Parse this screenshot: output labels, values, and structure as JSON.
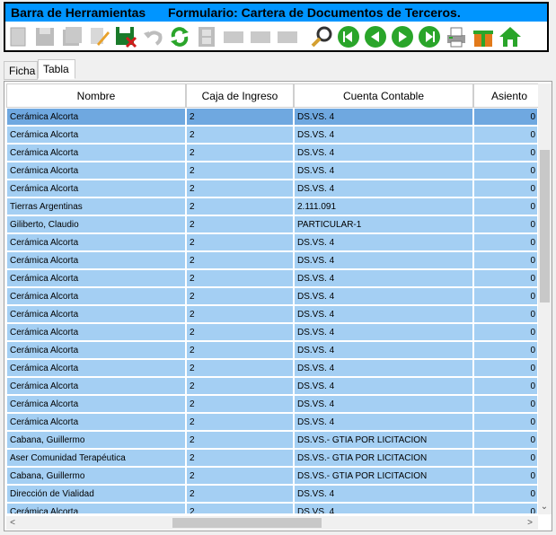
{
  "toolbar": {
    "title": "Barra de Herramientas",
    "form_title": "Formulario: Cartera de Documentos de Terceros.",
    "buttons": [
      {
        "name": "new-record-button",
        "icon": "document-icon",
        "enabled": false
      },
      {
        "name": "save-button",
        "icon": "floppy-icon",
        "enabled": false
      },
      {
        "name": "save-as-button",
        "icon": "floppy-stack-icon",
        "enabled": false
      },
      {
        "name": "edit-button",
        "icon": "pencil-icon",
        "enabled": false
      },
      {
        "name": "delete-button",
        "icon": "floppy-delete-icon",
        "enabled": true
      },
      {
        "name": "undo-button",
        "icon": "undo-icon",
        "enabled": false
      },
      {
        "name": "refresh-button",
        "icon": "refresh-icon",
        "enabled": true
      },
      {
        "name": "film-button",
        "icon": "film-icon",
        "enabled": false
      },
      {
        "name": "disabled-button-1",
        "icon": "blank-icon",
        "enabled": false
      },
      {
        "name": "disabled-button-2",
        "icon": "blank-icon",
        "enabled": false
      },
      {
        "name": "disabled-button-3",
        "icon": "blank-icon",
        "enabled": false
      },
      {
        "name": "search-button",
        "icon": "magnifier-icon",
        "enabled": true
      },
      {
        "name": "first-record-button",
        "icon": "first-icon",
        "enabled": true
      },
      {
        "name": "previous-record-button",
        "icon": "previous-icon",
        "enabled": true
      },
      {
        "name": "next-record-button",
        "icon": "next-icon",
        "enabled": true
      },
      {
        "name": "last-record-button",
        "icon": "last-icon",
        "enabled": true
      },
      {
        "name": "print-button",
        "icon": "printer-icon",
        "enabled": true
      },
      {
        "name": "gift-button",
        "icon": "gift-icon",
        "enabled": true
      },
      {
        "name": "home-button",
        "icon": "home-icon",
        "enabled": true
      }
    ]
  },
  "tabs": [
    {
      "label": "Ficha",
      "active": false
    },
    {
      "label": "Tabla",
      "active": true
    }
  ],
  "grid": {
    "columns": [
      "Nombre",
      "Caja de Ingreso",
      "Cuenta Contable",
      "Asiento"
    ],
    "rows": [
      {
        "nombre": "Cerámica Alcorta",
        "caja": "2",
        "cuenta": "DS.VS. 4",
        "asiento": "0",
        "selected": true
      },
      {
        "nombre": "Cerámica Alcorta",
        "caja": "2",
        "cuenta": "DS.VS. 4",
        "asiento": "0"
      },
      {
        "nombre": "Cerámica Alcorta",
        "caja": "2",
        "cuenta": "DS.VS. 4",
        "asiento": "0"
      },
      {
        "nombre": "Cerámica Alcorta",
        "caja": "2",
        "cuenta": "DS.VS. 4",
        "asiento": "0"
      },
      {
        "nombre": "Cerámica Alcorta",
        "caja": "2",
        "cuenta": "DS.VS. 4",
        "asiento": "0"
      },
      {
        "nombre": "Tierras Argentinas",
        "caja": "2",
        "cuenta": "2.111.091",
        "asiento": "0"
      },
      {
        "nombre": "Giliberto, Claudio",
        "caja": "2",
        "cuenta": "PARTICULAR-1",
        "asiento": "0"
      },
      {
        "nombre": "Cerámica Alcorta",
        "caja": "2",
        "cuenta": "DS.VS. 4",
        "asiento": "0"
      },
      {
        "nombre": "Cerámica Alcorta",
        "caja": "2",
        "cuenta": "DS.VS. 4",
        "asiento": "0"
      },
      {
        "nombre": "Cerámica Alcorta",
        "caja": "2",
        "cuenta": "DS.VS. 4",
        "asiento": "0"
      },
      {
        "nombre": "Cerámica Alcorta",
        "caja": "2",
        "cuenta": "DS.VS. 4",
        "asiento": "0"
      },
      {
        "nombre": "Cerámica Alcorta",
        "caja": "2",
        "cuenta": "DS.VS. 4",
        "asiento": "0"
      },
      {
        "nombre": "Cerámica Alcorta",
        "caja": "2",
        "cuenta": "DS.VS. 4",
        "asiento": "0"
      },
      {
        "nombre": "Cerámica Alcorta",
        "caja": "2",
        "cuenta": "DS.VS. 4",
        "asiento": "0"
      },
      {
        "nombre": "Cerámica Alcorta",
        "caja": "2",
        "cuenta": "DS.VS. 4",
        "asiento": "0"
      },
      {
        "nombre": "Cerámica Alcorta",
        "caja": "2",
        "cuenta": "DS.VS. 4",
        "asiento": "0"
      },
      {
        "nombre": "Cerámica Alcorta",
        "caja": "2",
        "cuenta": "DS.VS. 4",
        "asiento": "0"
      },
      {
        "nombre": "Cerámica Alcorta",
        "caja": "2",
        "cuenta": "DS.VS. 4",
        "asiento": "0"
      },
      {
        "nombre": "Cabana, Guillermo",
        "caja": "2",
        "cuenta": "DS.VS.- GTIA POR LICITACION",
        "asiento": "0"
      },
      {
        "nombre": "Aser Comunidad Terapéutica",
        "caja": "2",
        "cuenta": "DS.VS.- GTIA POR LICITACION",
        "asiento": "0"
      },
      {
        "nombre": "Cabana, Guillermo",
        "caja": "2",
        "cuenta": "DS.VS.- GTIA POR LICITACION",
        "asiento": "0"
      },
      {
        "nombre": "Dirección de Vialidad",
        "caja": "2",
        "cuenta": "DS.VS. 4",
        "asiento": "0"
      },
      {
        "nombre": "Cerámica Alcorta",
        "caja": "2",
        "cuenta": "DS.VS. 4",
        "asiento": "0"
      }
    ]
  },
  "colors": {
    "title_bar": "#0095ff",
    "row_bg": "#a4cff3",
    "row_selected_bg": "#6fa8e0",
    "nav_green": "#2aa52a"
  }
}
